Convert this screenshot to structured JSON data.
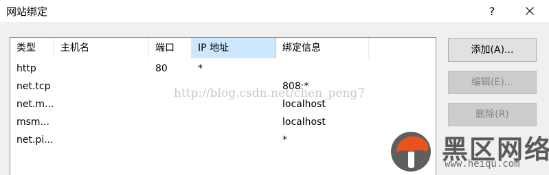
{
  "window": {
    "title": "网站绑定",
    "help_label": "?",
    "close_icon": "close-icon"
  },
  "table": {
    "columns": [
      "类型",
      "主机名",
      "端口",
      "IP 地址",
      "绑定信息"
    ],
    "rows": [
      [
        "http",
        "",
        "80",
        "*",
        ""
      ],
      [
        "net.tcp",
        "",
        "",
        "",
        "808:*"
      ],
      [
        "net.m...",
        "",
        "",
        "",
        "localhost"
      ],
      [
        "msm...",
        "",
        "",
        "",
        "localhost"
      ],
      [
        "net.pi...",
        "",
        "",
        "",
        "*"
      ]
    ]
  },
  "buttons": {
    "add": "添加(A)...",
    "edit": "编辑(E)...",
    "remove": "删除(R)"
  },
  "watermark": {
    "url": "http://blog.csdn.net/chen_peng7",
    "brand_icon": "mushroom-logo-icon",
    "brand_name": "黑区网络",
    "brand_site": "www.heiqu.com",
    "brand_color": "#e8541c"
  }
}
